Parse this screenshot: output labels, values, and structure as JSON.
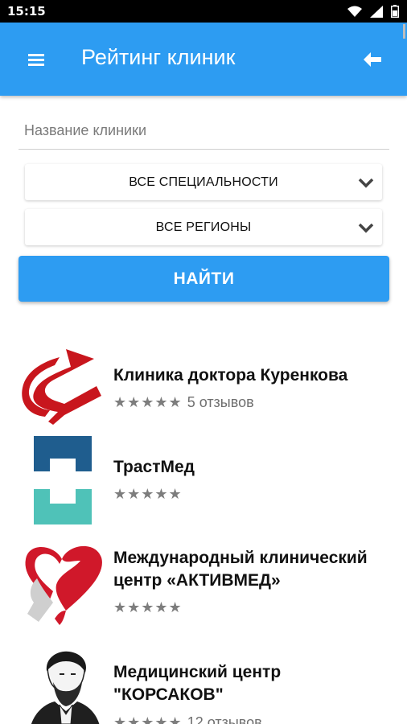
{
  "status": {
    "time": "15:15"
  },
  "app_bar": {
    "title": "Рейтинг клиник",
    "menu_icon": "menu-icon",
    "back_icon": "back-arrow-icon"
  },
  "search": {
    "placeholder": "Название клиники",
    "value": ""
  },
  "filters": {
    "specialty": "ВСЕ СПЕЦИАЛЬНОСТИ",
    "region": "ВСЕ РЕГИОНЫ"
  },
  "find_button": "НАЙТИ",
  "colors": {
    "primary": "#2d9cf2",
    "star": "#7d7d7d"
  },
  "clinics": [
    {
      "name": "Клиника доктора Куренкова",
      "stars": "★★★★★",
      "reviews": "5 отзывов"
    },
    {
      "name": "ТрастМед",
      "stars": "★★★★★",
      "reviews": ""
    },
    {
      "name": "Международный клинический центр «АКТИВМЕД»",
      "stars": "★★★★★",
      "reviews": ""
    },
    {
      "name": "Медицинский центр \"КОРСАКОВ\"",
      "stars": "★★★★★",
      "reviews": "12 отзывов"
    }
  ]
}
